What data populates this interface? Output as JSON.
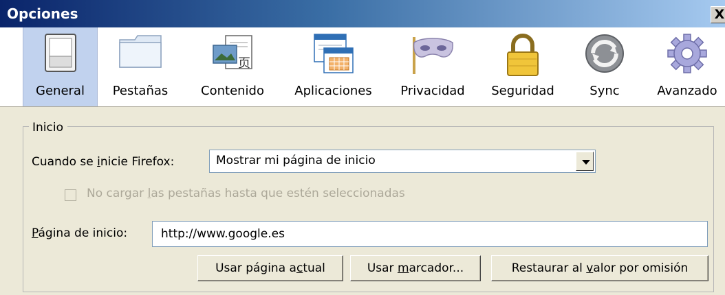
{
  "window": {
    "title": "Opciones",
    "close_glyph": "X"
  },
  "toolbar": {
    "items": [
      {
        "label": "General",
        "icon": "switch-icon",
        "selected": true
      },
      {
        "label": "Pestañas",
        "icon": "folder-tabs-icon"
      },
      {
        "label": "Contenido",
        "icon": "content-icon"
      },
      {
        "label": "Aplicaciones",
        "icon": "applications-icon"
      },
      {
        "label": "Privacidad",
        "icon": "mask-icon"
      },
      {
        "label": "Seguridad",
        "icon": "padlock-icon"
      },
      {
        "label": "Sync",
        "icon": "sync-icon"
      },
      {
        "label": "Avanzado",
        "icon": "gear-icon"
      }
    ]
  },
  "startup": {
    "legend": "Inicio",
    "when_label_pre": "Cuando se ",
    "when_label_key": "i",
    "when_label_post": "nicie Firefox:",
    "when_value": "Mostrar mi página de inicio",
    "lazy_pre": "No cargar ",
    "lazy_key": "l",
    "lazy_post": "as pestañas hasta que estén seleccionadas",
    "lazy_checked": false,
    "home_label_key": "P",
    "home_label_post": "ágina de inicio:",
    "home_value": "http://www.google.es",
    "btn_current_pre": "Usar página a",
    "btn_current_key": "c",
    "btn_current_post": "tual",
    "btn_bookmark_pre": "Usar ",
    "btn_bookmark_key": "m",
    "btn_bookmark_post": "arcador...",
    "btn_restore_pre": "Restaurar al ",
    "btn_restore_key": "v",
    "btn_restore_post": "alor por omisión"
  }
}
